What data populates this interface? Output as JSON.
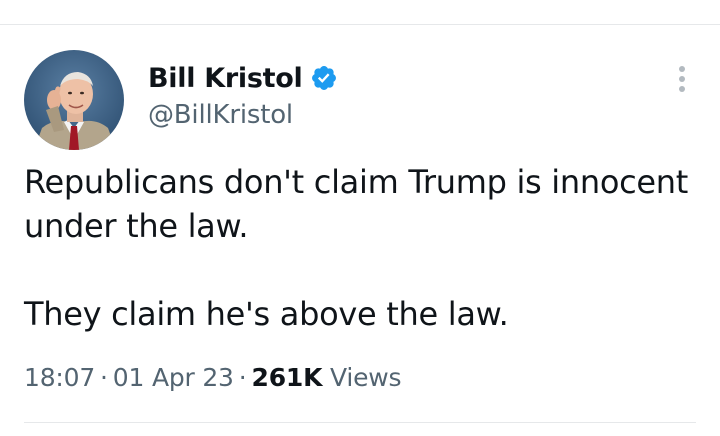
{
  "author": {
    "display_name": "Bill Kristol",
    "handle": "@BillKristol",
    "verified": true,
    "verified_color": "#1d9bf0"
  },
  "icons": {
    "avatar": "profile-photo",
    "verified": "verified-badge-icon",
    "more": "more-vertical-icon"
  },
  "tweet": {
    "paragraphs": [
      "Republicans don't claim Trump is innocent under the law.",
      "They claim he's above the law."
    ]
  },
  "meta": {
    "time": "18:07",
    "separator": "·",
    "date": "01 Apr 23",
    "views_count": "261K",
    "views_label": "Views"
  }
}
